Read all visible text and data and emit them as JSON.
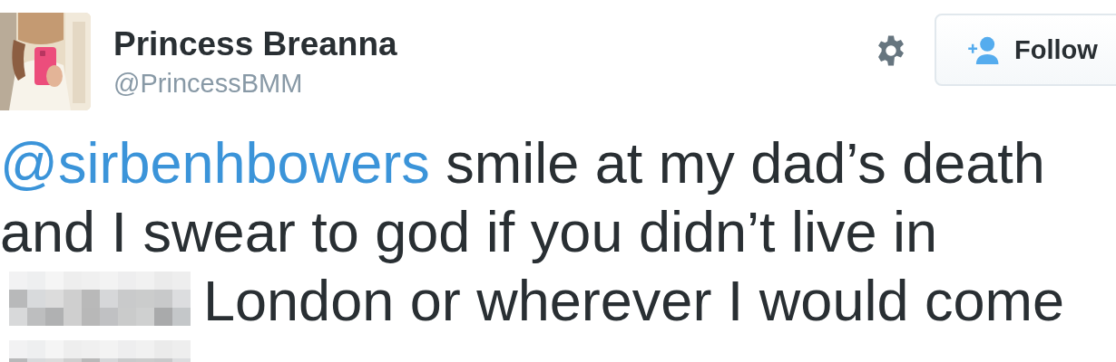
{
  "author": {
    "name": "Princess Breanna",
    "handle": "@PrincessBMM"
  },
  "follow_button": {
    "label": "Follow"
  },
  "tweet": {
    "segments": [
      {
        "kind": "mention",
        "text": "@sirbenhbowers"
      },
      {
        "kind": "text",
        "text": " smile at my dad’s death"
      },
      {
        "kind": "break"
      },
      {
        "kind": "text",
        "text": "and I swear to god if you didn’t live in"
      },
      {
        "kind": "break"
      },
      {
        "kind": "redacted"
      },
      {
        "kind": "text",
        "text": "London or wherever I would come"
      },
      {
        "kind": "break"
      },
      {
        "kind": "redacted"
      }
    ]
  }
}
